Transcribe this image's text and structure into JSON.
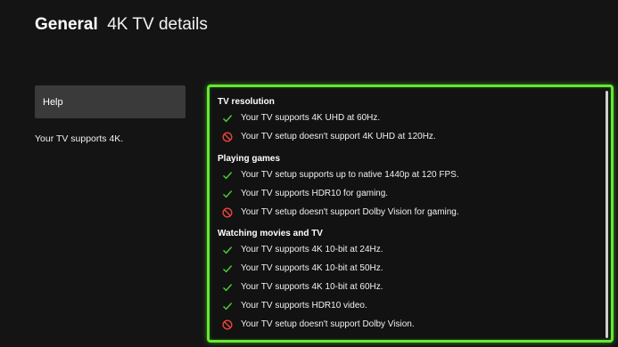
{
  "header": {
    "section": "General",
    "page": "4K TV details"
  },
  "sidebar": {
    "help_label": "Help",
    "summary": "Your TV supports 4K."
  },
  "colors": {
    "accent": "#62ea2f",
    "check": "#4cd137",
    "error": "#e8453c"
  },
  "groups": [
    {
      "title": "TV resolution",
      "items": [
        {
          "status": "check",
          "text": "Your TV supports 4K UHD at 60Hz."
        },
        {
          "status": "error",
          "text": "Your TV setup doesn't support 4K UHD at 120Hz."
        }
      ]
    },
    {
      "title": "Playing games",
      "items": [
        {
          "status": "check",
          "text": "Your TV setup supports up to native 1440p at 120 FPS."
        },
        {
          "status": "check",
          "text": "Your TV supports HDR10 for gaming."
        },
        {
          "status": "error",
          "text": "Your TV setup doesn't support Dolby Vision for gaming."
        }
      ]
    },
    {
      "title": "Watching movies and TV",
      "items": [
        {
          "status": "check",
          "text": "Your TV supports 4K 10-bit at 24Hz."
        },
        {
          "status": "check",
          "text": "Your TV supports 4K 10-bit at 50Hz."
        },
        {
          "status": "check",
          "text": "Your TV supports 4K 10-bit at 60Hz."
        },
        {
          "status": "check",
          "text": "Your TV supports HDR10 video."
        },
        {
          "status": "error",
          "text": "Your TV setup doesn't support Dolby Vision."
        }
      ]
    }
  ]
}
